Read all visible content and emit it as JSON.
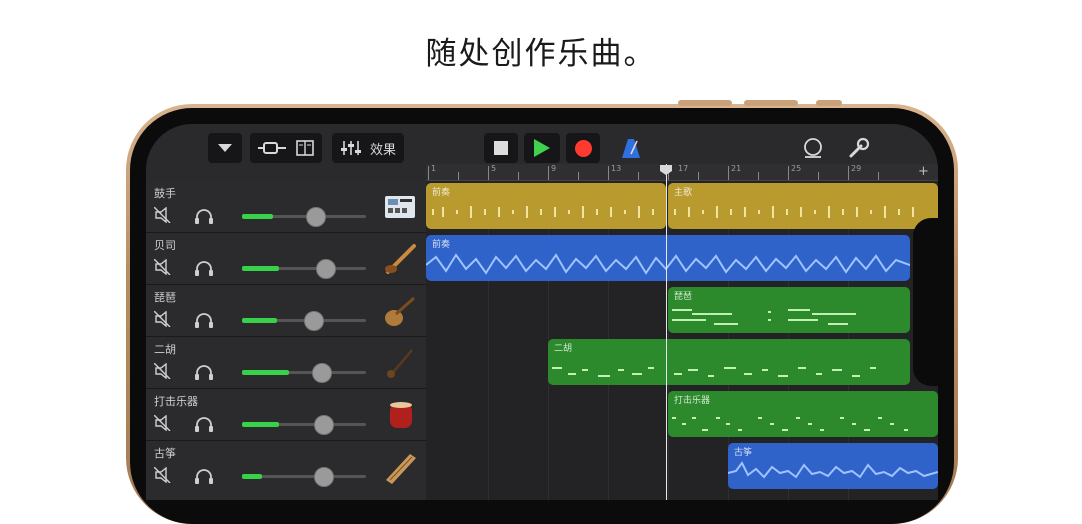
{
  "headline": "随处创作乐曲。",
  "toolbar": {
    "effects_label": "效果"
  },
  "colors": {
    "drummer_region": "#b89a2e",
    "audio_region": "#2f63c9",
    "midi_region": "#2c8a2c",
    "play_green": "#3fd24f",
    "record_red": "#ff3b30",
    "metronome_blue": "#2f6fe0"
  },
  "tracks": [
    {
      "name": "鼓手",
      "volume": 0.25,
      "icon": "drum-machine-icon"
    },
    {
      "name": "贝司",
      "volume": 0.3,
      "icon": "bass-guitar-icon"
    },
    {
      "name": "琵琶",
      "volume": 0.28,
      "icon": "pipa-icon"
    },
    {
      "name": "二胡",
      "volume": 0.38,
      "icon": "erhu-icon"
    },
    {
      "name": "打击乐器",
      "volume": 0.3,
      "icon": "chinese-drum-icon"
    },
    {
      "name": "古筝",
      "volume": 0.16,
      "icon": "guzheng-icon"
    }
  ],
  "regions": [
    {
      "label": "前奏",
      "track": 0
    },
    {
      "label": "主歌",
      "track": 0
    },
    {
      "label": "前奏",
      "track": 1
    },
    {
      "label": "琵琶",
      "track": 2
    },
    {
      "label": "二胡",
      "track": 3
    },
    {
      "label": "打击乐器",
      "track": 4
    },
    {
      "label": "古筝",
      "track": 5
    }
  ],
  "ruler": {
    "bar_numbers": [
      "1",
      "5",
      "9",
      "13",
      "17",
      "21",
      "25",
      "29"
    ]
  }
}
